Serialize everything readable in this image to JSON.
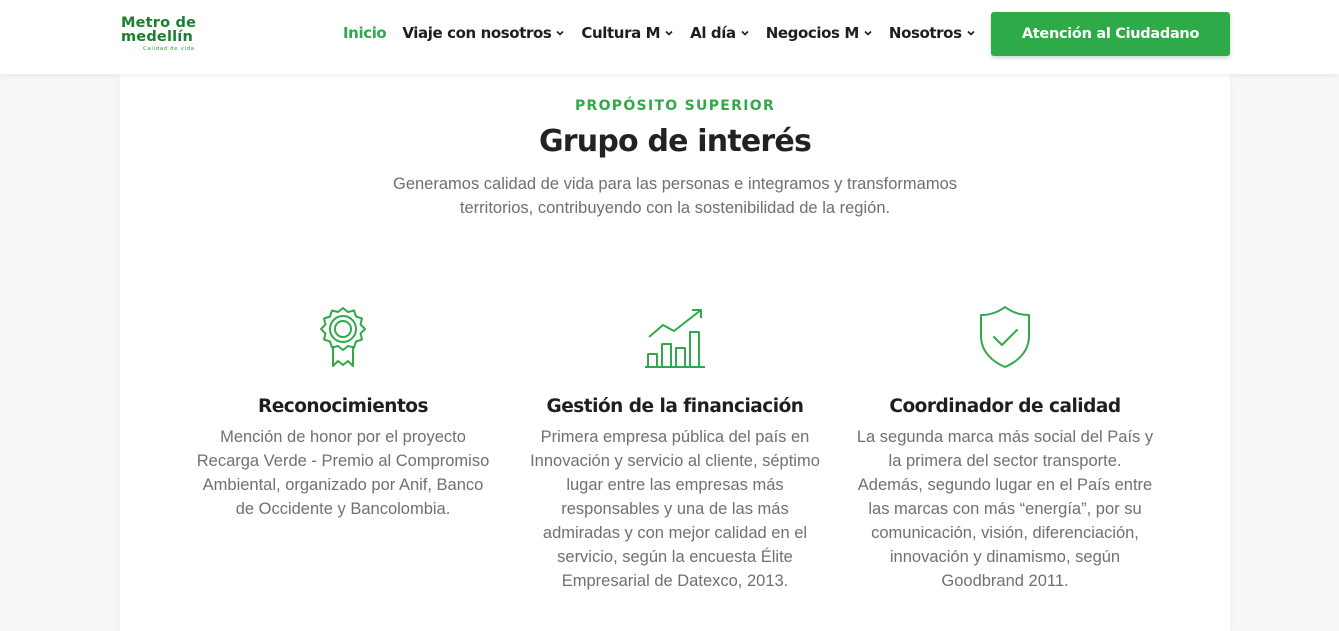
{
  "header": {
    "logo": {
      "line1": "Metro de",
      "line2": "medellín",
      "tagline": "Calidad de vida"
    },
    "nav": [
      {
        "label": "Inicio",
        "active": true,
        "dropdown": false
      },
      {
        "label": "Viaje con nosotros",
        "active": false,
        "dropdown": true
      },
      {
        "label": "Cultura M",
        "active": false,
        "dropdown": true
      },
      {
        "label": "Al día",
        "active": false,
        "dropdown": true
      },
      {
        "label": "Negocios M",
        "active": false,
        "dropdown": true
      },
      {
        "label": "Nosotros",
        "active": false,
        "dropdown": true
      }
    ],
    "cta_label": "Atención al Ciudadano"
  },
  "section": {
    "eyebrow": "PROPÓSITO SUPERIOR",
    "title": "Grupo de interés",
    "subtitle": "Generamos calidad de vida para las personas e integramos y transformamos territorios, contribuyendo con la sostenibilidad de la región."
  },
  "features": [
    {
      "icon": "award-ribbon-icon",
      "title": "Reconocimientos",
      "text": "Mención de honor por el proyecto Recarga Verde - Premio al Compromiso Ambiental, organizado por Anif, Banco de Occidente y Bancolombia."
    },
    {
      "icon": "growth-chart-icon",
      "title": "Gestión de la financiación",
      "text": "Primera empresa pública del país en Innovación y servicio al cliente, séptimo lugar entre las empresas más responsables y una de las más admiradas y con mejor calidad en el servicio, según la encuesta Élite Empresarial de Datexco, 2013."
    },
    {
      "icon": "shield-check-icon",
      "title": "Coordinador de calidad",
      "text": "La segunda marca más social del País y la primera del sector transporte. Además, segundo lugar en el País entre las marcas con más “energía”, por su comunicación, visión, diferenciación, innovación y dinamismo, según Goodbrand 2011."
    }
  ],
  "colors": {
    "accent": "#31a94a",
    "cta_bg": "#2eaa48",
    "logo": "#1a7f2e",
    "heading": "#222222",
    "body_text": "#707070"
  }
}
